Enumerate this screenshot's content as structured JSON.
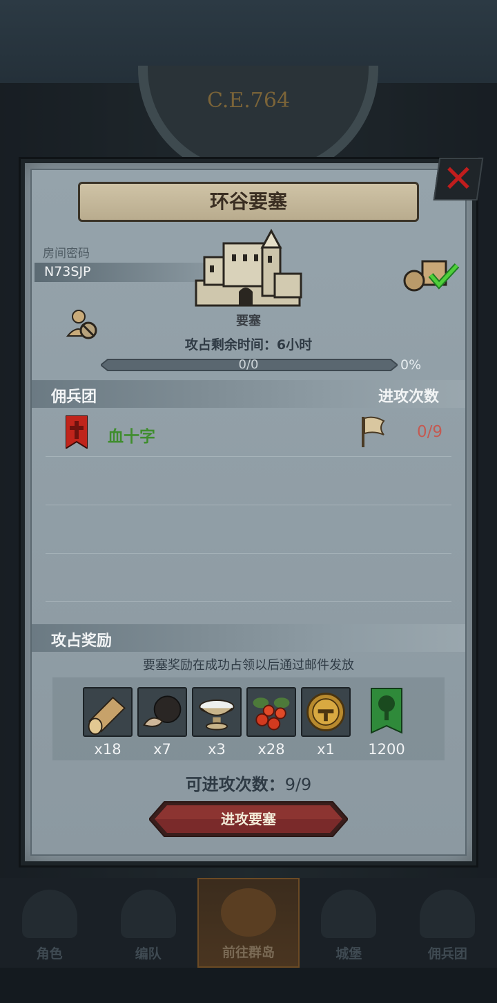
{
  "era": "C.E.764",
  "dialog": {
    "title": "环谷要塞",
    "room_label": "房间密码",
    "room_code": "N73SJP",
    "fort_type": "要塞",
    "time_remaining": "攻占剩余时间：6小时",
    "progress_text": "0/0",
    "progress_pct": "0%",
    "progress_fraction": 0
  },
  "guild_section": {
    "left_header": "佣兵团",
    "right_header": "进攻次数",
    "rows": [
      {
        "name": "血十字",
        "count": "0/9"
      }
    ]
  },
  "reward_section": {
    "header": "攻占奖励",
    "note": "要塞奖励在成功占领以后通过邮件发放",
    "items": [
      {
        "icon": "wood-log-icon",
        "qty": "x18"
      },
      {
        "icon": "truffle-icon",
        "qty": "x7"
      },
      {
        "icon": "cream-bowl-icon",
        "qty": "x3"
      },
      {
        "icon": "berries-icon",
        "qty": "x28"
      },
      {
        "icon": "golden-helmet-icon",
        "qty": "x1"
      }
    ],
    "banner": {
      "icon": "tree-banner-icon",
      "qty": "1200"
    }
  },
  "attempts": {
    "label": "可进攻次数：",
    "value": "9/9"
  },
  "attack_button": "进攻要塞",
  "nav": [
    {
      "label": "角色"
    },
    {
      "label": "编队"
    },
    {
      "label": "前往群岛"
    },
    {
      "label": "城堡"
    },
    {
      "label": "佣兵团"
    }
  ],
  "colors": {
    "guild_name": "#3f8d2d",
    "attack_count": "#c45a52",
    "close_x": "#c01d1d",
    "button": "#7a2a2a"
  }
}
